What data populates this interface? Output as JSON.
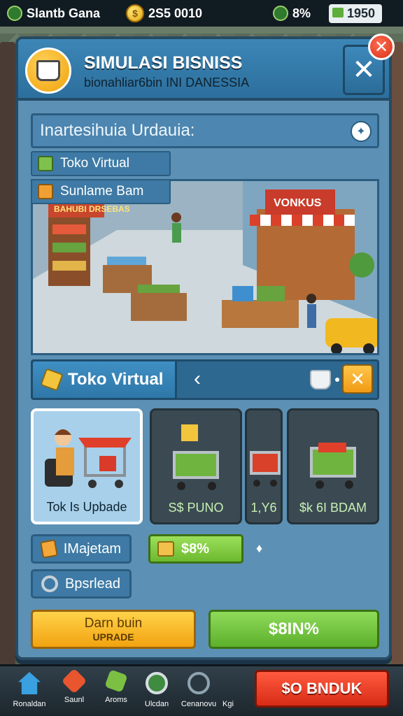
{
  "status_bar": {
    "player_name": "Slantb Gana",
    "coins": "2S5 0010",
    "gem_percent": "8%",
    "cash": "1950"
  },
  "panel": {
    "title": "SIMULASI BISNISS",
    "subtitle": "bionahliar6bin INI DANESSIA",
    "close_symbol": "✕",
    "close_badge_symbol": "✕",
    "section_title": "Inartesihuia Urdauia:",
    "tags": [
      {
        "label": "Toko Virtual",
        "icon": "ticket-icon"
      },
      {
        "label": "Sunlame Bam",
        "icon": "crate-icon"
      }
    ],
    "scene_sign_left": "BAHUBI DRSEBAS",
    "scene_sign_right": "VONKUS"
  },
  "store_bar": {
    "name": "Toko Virtual",
    "back_symbol": "‹",
    "close_symbol": "✕"
  },
  "cards": [
    {
      "label": "Tok Is Upbade",
      "selected": true
    },
    {
      "label": "S$ PUNO",
      "selected": false
    },
    {
      "label": "1,Y6",
      "selected": false
    },
    {
      "label": "$k 6I BDAM",
      "selected": false
    }
  ],
  "stats": {
    "marketing_label": "IMajetam",
    "percent_value": "$8%",
    "speed_label": "Bpsrlead",
    "pin_symbol": "♦"
  },
  "actions": {
    "upgrade_line1": "Darn buin",
    "upgrade_line2": "UPRADE",
    "green_label": "$8IN%"
  },
  "bottom_nav": [
    {
      "label": "Ronaldan",
      "icon": "house-icon",
      "color": "#3aa0e0"
    },
    {
      "label": "Saunl",
      "icon": "shop-icon",
      "color": "#e8552e"
    },
    {
      "label": "Aroms",
      "icon": "hammer-icon",
      "color": "#7bc043"
    },
    {
      "label": "Ulcdan",
      "icon": "target-icon",
      "color": "#d6dde2"
    },
    {
      "label": "Cenanovu",
      "icon": "gauge-icon",
      "color": "#8fa3b0"
    },
    {
      "label": "Kgi",
      "icon": "none",
      "color": "#1c262d"
    }
  ],
  "big_button_label": "$O BNDUK",
  "colors": {
    "panel": "#5c90b4",
    "header": "#2c6f9d",
    "accent_orange": "#f2a310",
    "accent_green": "#6cb92f",
    "accent_red": "#d72c16"
  }
}
